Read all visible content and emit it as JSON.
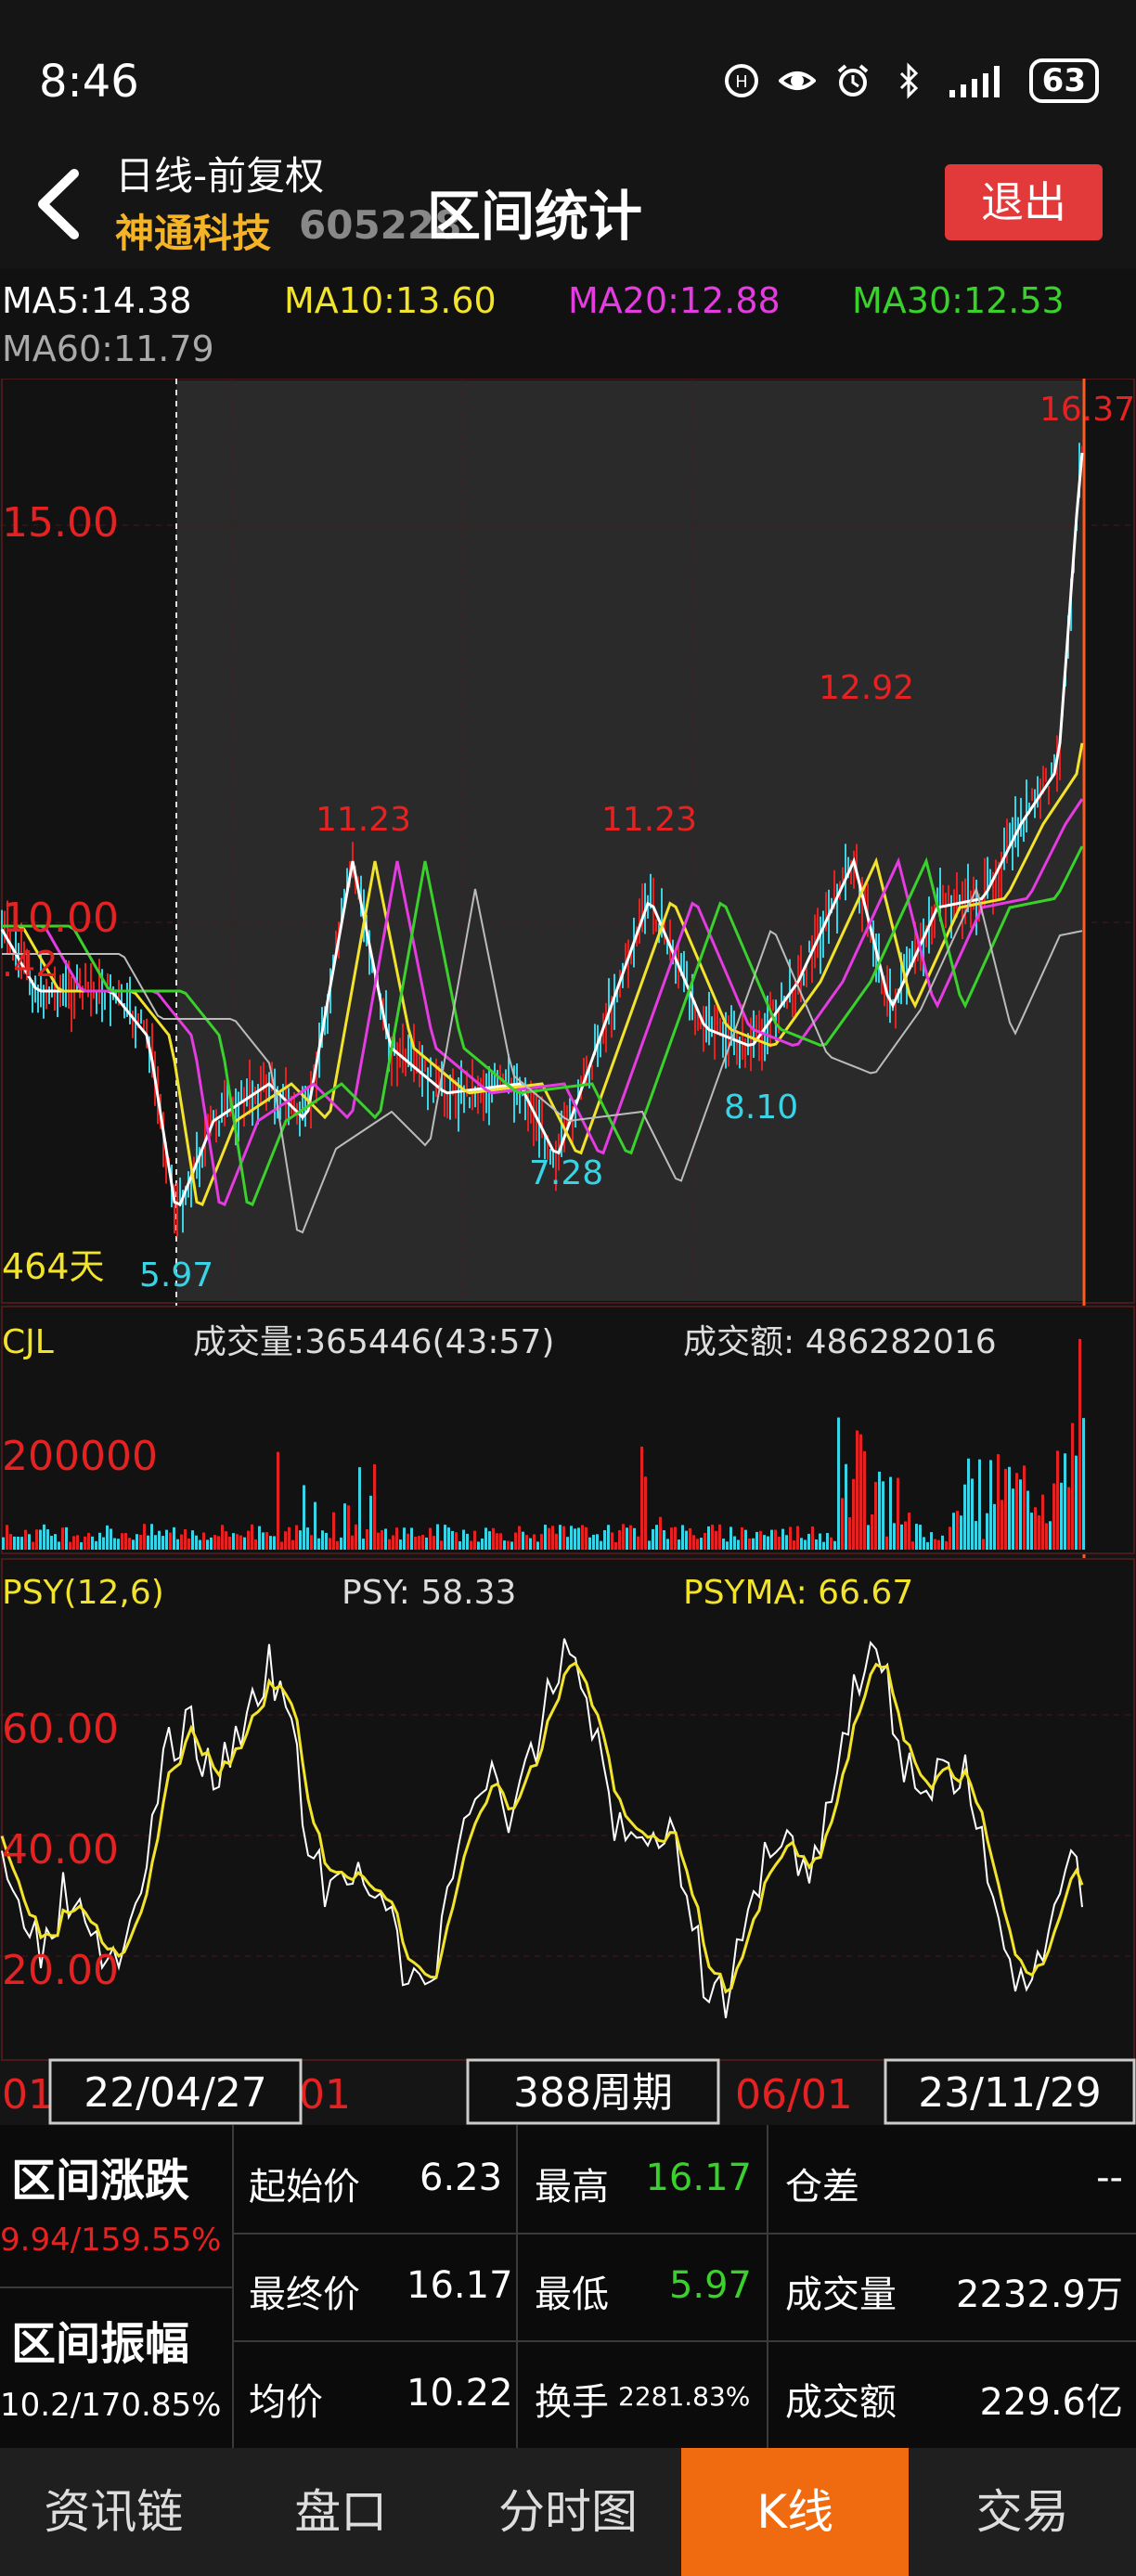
{
  "status_bar": {
    "time": "8:46",
    "battery": "63",
    "icons": [
      "hd-icon",
      "eye-icon",
      "alarm-icon",
      "bluetooth-icon",
      "signal-icon",
      "battery-icon"
    ]
  },
  "header": {
    "period": "日线-前复权",
    "stock_name": "神通科技",
    "stock_code": "605228",
    "title": "区间统计",
    "exit_label": "退出"
  },
  "ma": {
    "ma5": "MA5:14.38",
    "ma10": "MA10:13.60",
    "ma20": "MA20:12.88",
    "ma30": "MA30:12.53",
    "ma60": "MA60:11.79"
  },
  "colors": {
    "ma5": "#ffffff",
    "ma10": "#f2e32c",
    "ma20": "#e43ce0",
    "ma30": "#3ad12c",
    "ma60": "#bbbbbb",
    "up": "#e52222",
    "down": "#39d3e6",
    "accent": "#f06a10"
  },
  "main_chart": {
    "y_labels": [
      "15.00",
      "10.00"
    ],
    "left_value": ".42",
    "days_label": "464天",
    "annotations": {
      "max_right": "16.37",
      "peak1": "11.23",
      "peak2": "11.23",
      "peak3": "12.92",
      "low1": "5.97",
      "low2": "7.28",
      "low3": "8.10"
    }
  },
  "volume": {
    "name": "CJL",
    "vol_label": "成交量:365446(43:57)",
    "amount_label": "成交额: 486282016",
    "y_label": "200000"
  },
  "psy": {
    "name": "PSY(12,6)",
    "psy_label": "PSY: 58.33",
    "psyma_label": "PSYMA: 66.67",
    "y_labels": [
      "60.00",
      "40.00",
      "20.00"
    ]
  },
  "x_axis": {
    "left_partial": "01",
    "mid_partial": "01",
    "right_partial": "06/01",
    "start_date": "22/04/27",
    "period": "388周期",
    "end_date": "23/11/29"
  },
  "stats": {
    "range_change_title": "区间涨跌",
    "range_change_value": "9.94/159.55%",
    "range_amp_title": "区间振幅",
    "range_amp_value": "10.2/170.85%",
    "start_price_label": "起始价",
    "start_price": "6.23",
    "end_price_label": "最终价",
    "end_price": "16.17",
    "avg_label": "均价",
    "avg": "10.22",
    "high_label": "最高",
    "high": "16.17",
    "low_label": "最低",
    "low": "5.97",
    "turnover_label": "换手",
    "turnover": "2281.83%",
    "position_label": "仓差",
    "position": "--",
    "volume_label": "成交量",
    "volume": "2232.9万",
    "amount_label": "成交额",
    "amount": "229.6亿"
  },
  "tabs": [
    "资讯链",
    "盘口",
    "分时图",
    "K线",
    "交易"
  ],
  "active_tab": "K线"
}
